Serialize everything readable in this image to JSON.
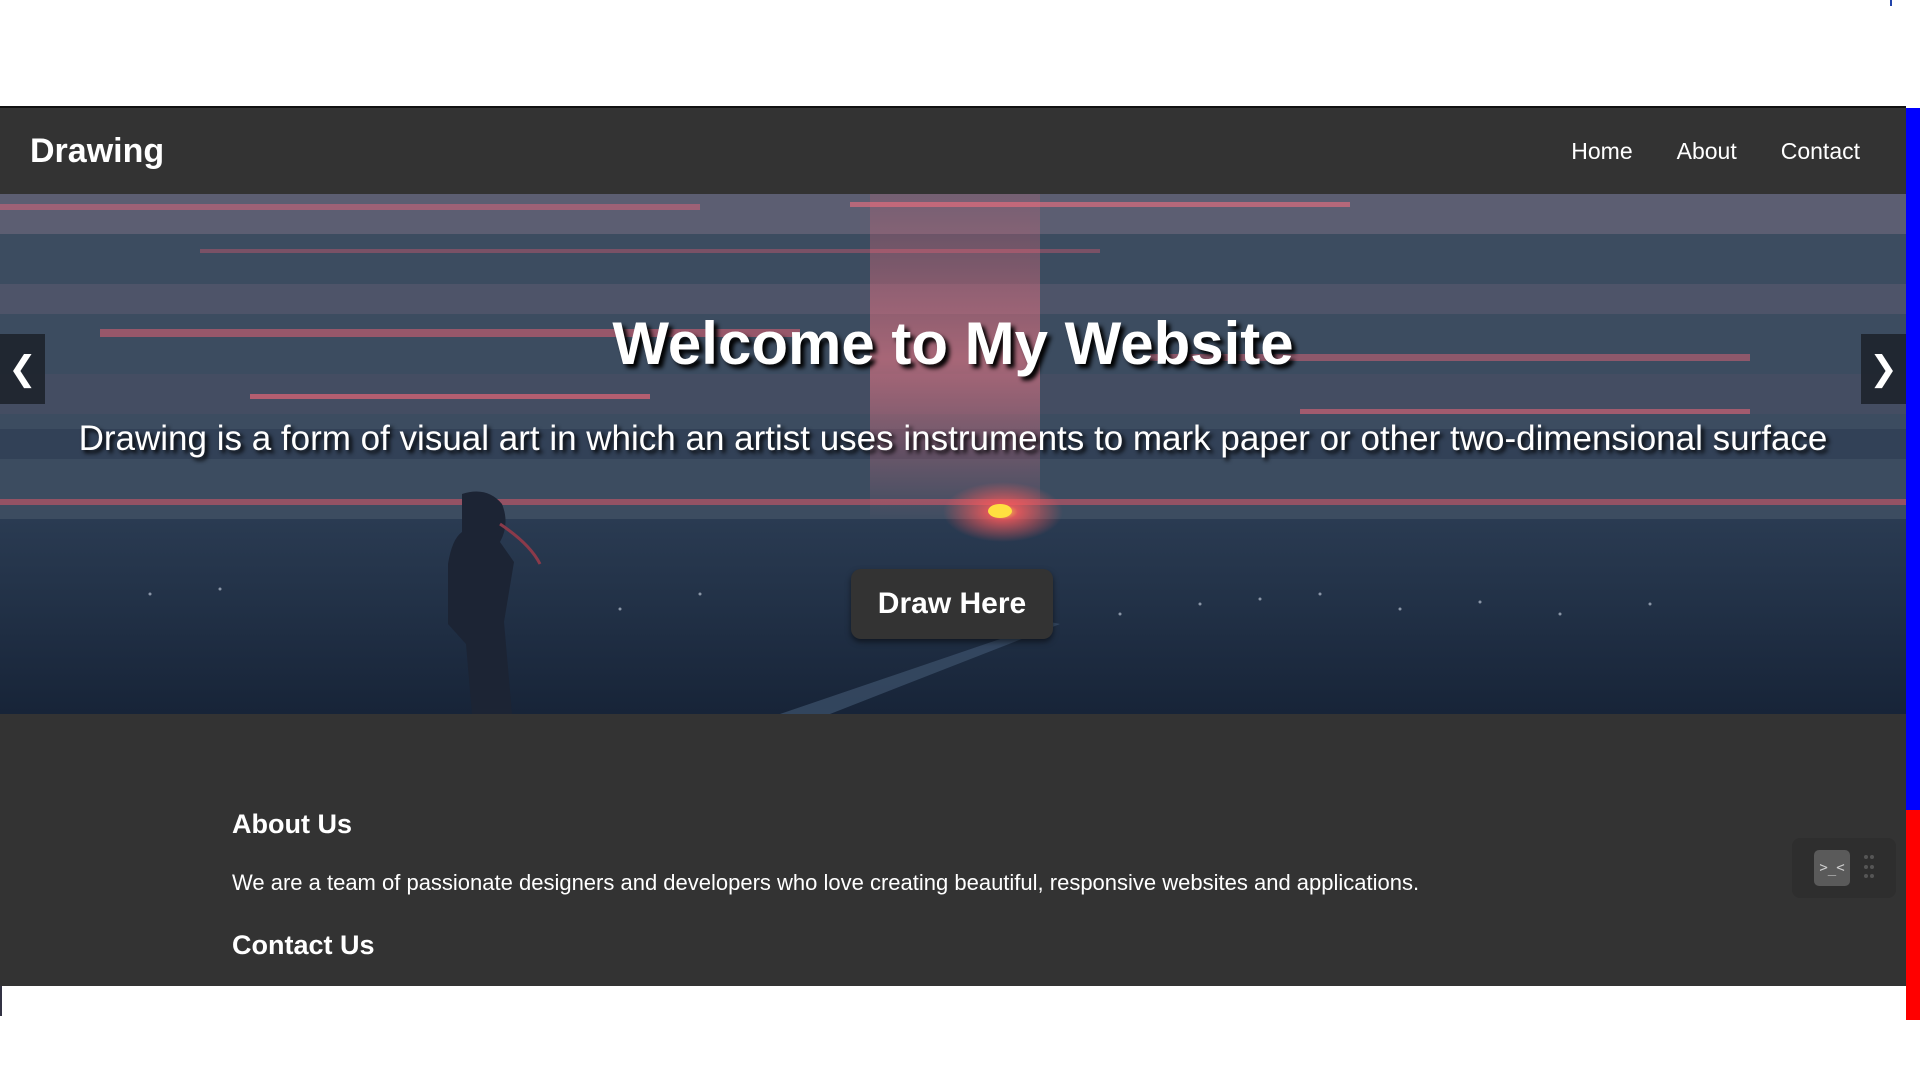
{
  "navbar": {
    "brand": "Drawing",
    "links": [
      "Home",
      "About",
      "Contact"
    ]
  },
  "hero": {
    "title": "Welcome to My Website",
    "subtitle": "Drawing is a form of visual art in which an artist uses instruments to mark paper or other two-dimensional surface",
    "cta_label": "Draw Here",
    "prev_arrow": "❮",
    "next_arrow": "❯"
  },
  "about": {
    "heading": "About Us",
    "text": "We are a team of passionate designers and developers who love creating beautiful, responsive websites and applications."
  },
  "contact": {
    "heading": "Contact Us"
  },
  "widget": {
    "icon_glyph": ">_<"
  },
  "colors": {
    "nav_bg": "#333333",
    "accent_blue": "#0000ff",
    "accent_red": "#ff0000"
  }
}
